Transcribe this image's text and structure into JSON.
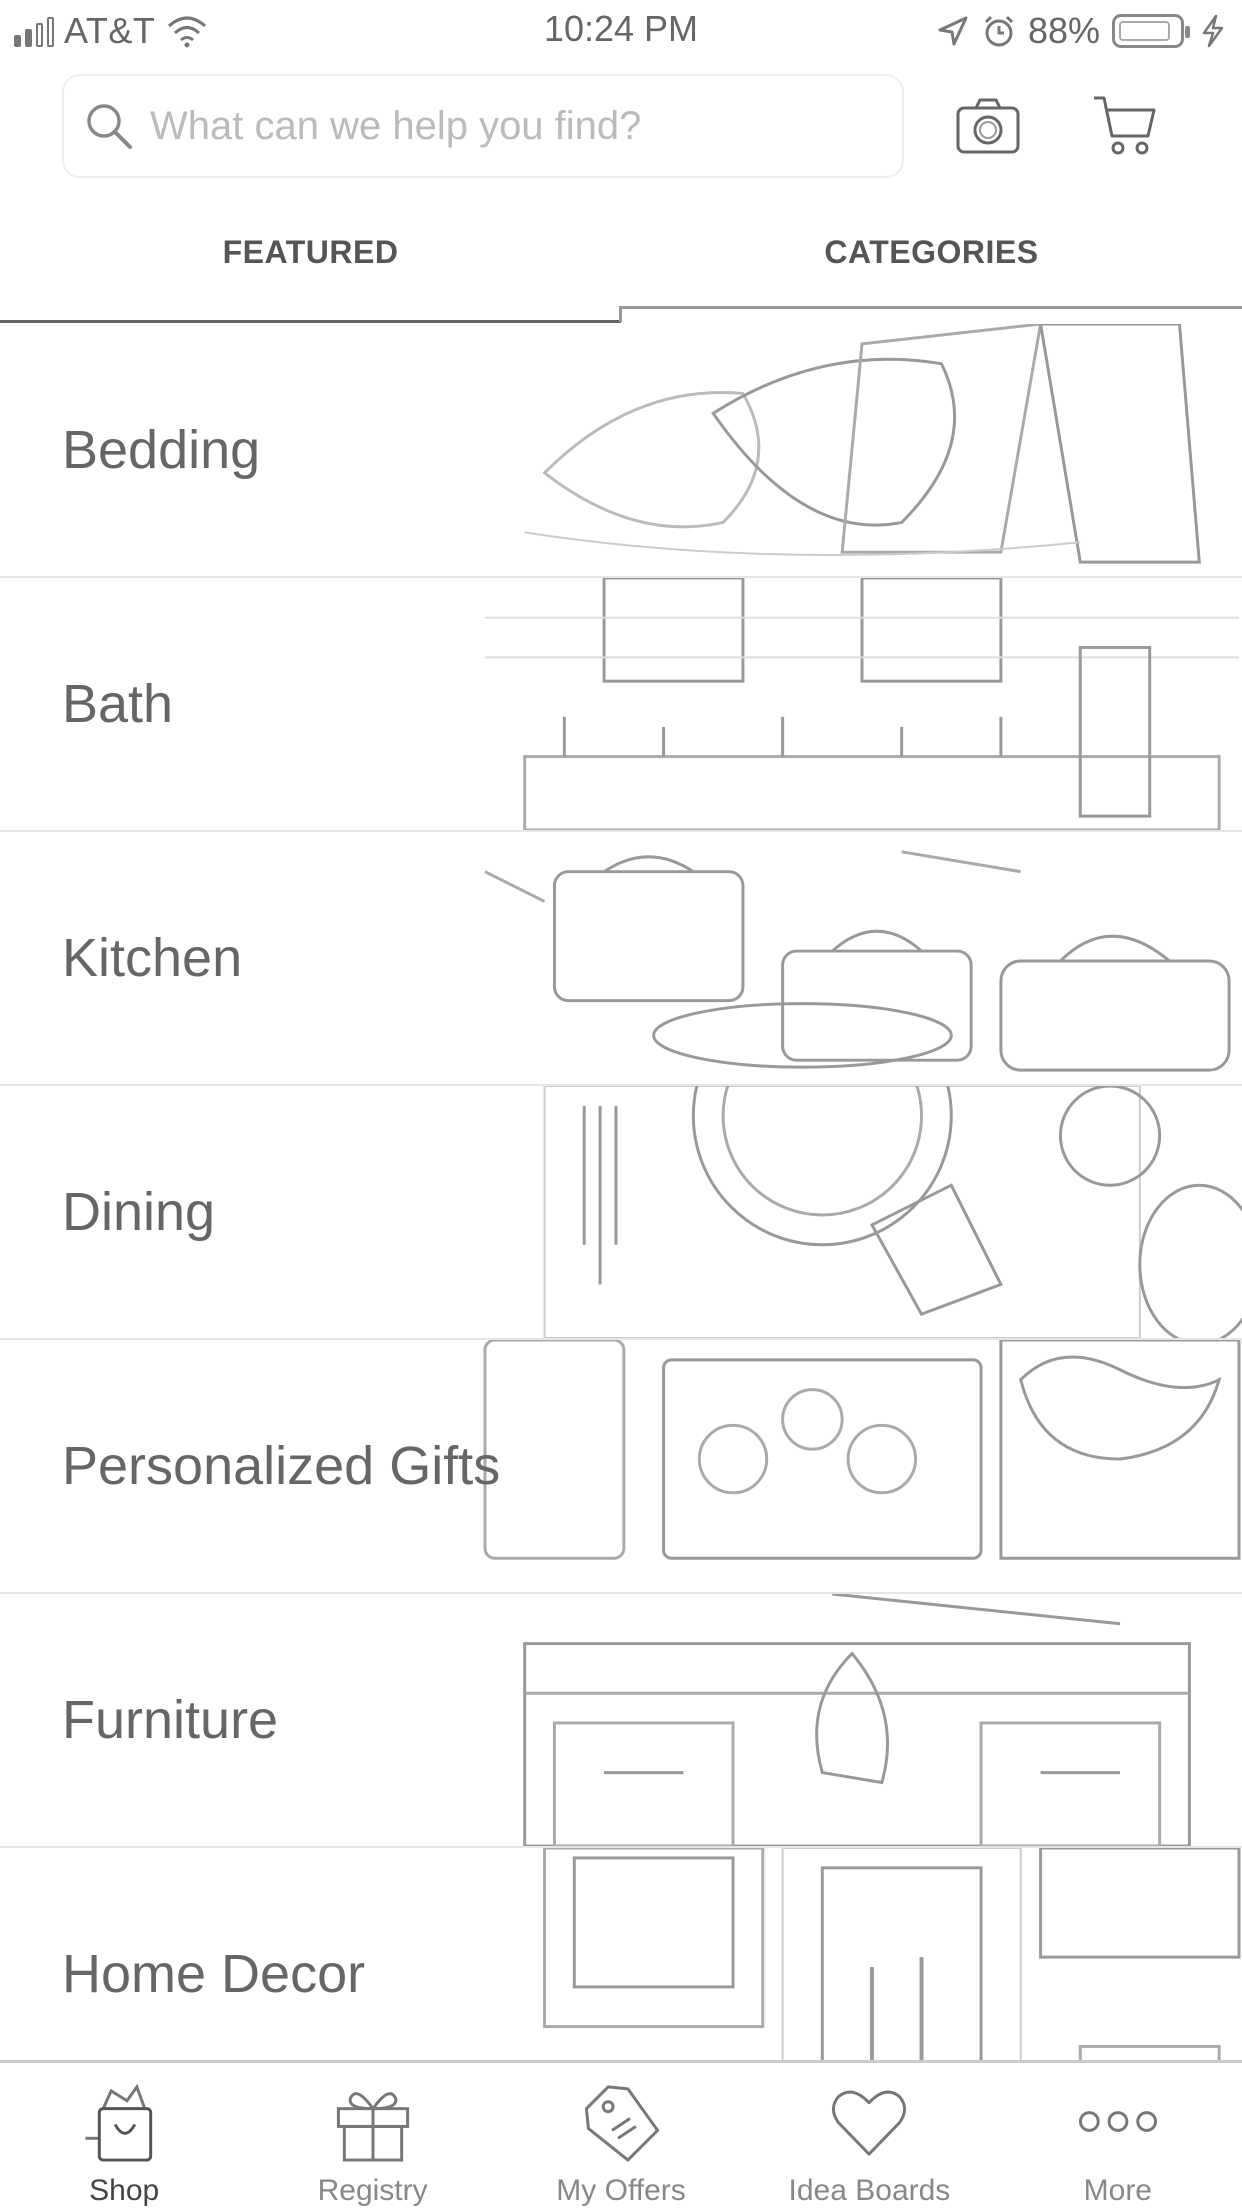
{
  "status_bar": {
    "carrier": "AT&T",
    "time": "10:24 PM",
    "battery_percent": "88%",
    "battery_level": 0.88
  },
  "search": {
    "placeholder": "What can we help you find?"
  },
  "tabs": [
    {
      "label": "FEATURED"
    },
    {
      "label": "CATEGORIES"
    }
  ],
  "categories": [
    {
      "label": "Bedding"
    },
    {
      "label": "Bath"
    },
    {
      "label": "Kitchen"
    },
    {
      "label": "Dining"
    },
    {
      "label": "Personalized Gifts"
    },
    {
      "label": "Furniture"
    },
    {
      "label": "Home Decor"
    }
  ],
  "bottom_nav": [
    {
      "label": "Shop",
      "icon": "shopping-bag-icon",
      "active": true
    },
    {
      "label": "Registry",
      "icon": "gift-icon"
    },
    {
      "label": "My Offers",
      "icon": "tag-icon"
    },
    {
      "label": "Idea Boards",
      "icon": "heart-icon"
    },
    {
      "label": "More",
      "icon": "more-dots-icon"
    }
  ]
}
